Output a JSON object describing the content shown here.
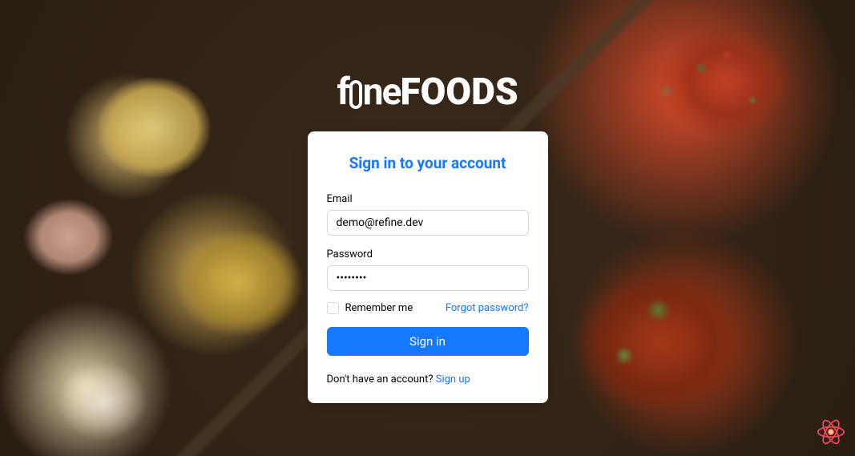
{
  "brand": {
    "part1": "f",
    "part2": "ne",
    "part3": "FOODS"
  },
  "card": {
    "title": "Sign in to your account"
  },
  "form": {
    "email_label": "Email",
    "email_value": "demo@refine.dev",
    "password_label": "Password",
    "password_value": "••••••••",
    "remember_label": "Remember me",
    "forgot_link": "Forgot password?",
    "submit_label": "Sign in"
  },
  "footer": {
    "no_account_text": "Don't have an account? ",
    "signup_link": "Sign up"
  },
  "colors": {
    "primary": "#1677ff",
    "card_bg": "#ffffff",
    "text": "#000000",
    "border": "#d9d9d9"
  }
}
